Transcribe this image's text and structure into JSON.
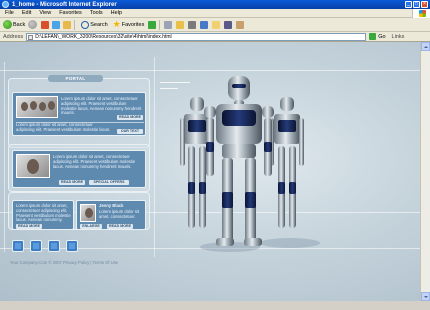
{
  "window": {
    "title": "1_home - Microsoft Internet Explorer",
    "buttons": [
      "_",
      "□",
      "×"
    ]
  },
  "menubar": {
    "items": [
      "File",
      "Edit",
      "View",
      "Favorites",
      "Tools",
      "Help"
    ]
  },
  "toolbar": {
    "back_label": "Back",
    "search_label": "Search",
    "favorites_label": "Favorites"
  },
  "addressbar": {
    "label": "Address",
    "value": "D:\\LEFAN\\_WORK_3200\\Resources\\32\\site\\4\\html\\index.html",
    "go_label": "Go",
    "links_label": "Links"
  },
  "page": {
    "panel_title": "PORTAL",
    "box1": {
      "text": "Lorem ipsum dolor sit amet, consectetuer adipiscing elit. Praesent vestibulum molestie lacus. Aenean nonummy hendrerit mauris.",
      "button": "READ MORE",
      "text2": "Lorem ipsum dolor sit amet, consectetuer adipiscing elit. Praesent vestibulum molestie lacus.",
      "button2": "OUR TEXT"
    },
    "box2": {
      "text": "Lorem ipsum dolor sit amet, consectetuer adipiscing elit. Praesent vestibulum molestie lacus. Aenean nonummy hendrerit mauris.",
      "button1": "READ MORE",
      "button2": "SPECIAL OFFERS"
    },
    "box3": {
      "text": "Lorem ipsum dolor sit amet, consectetuer adipiscing elit. Praesent vestibulum molestie lacus. Aenean nonummy.",
      "name": "Jenny Black",
      "name_text": "Lorem ipsum dolor sit amet, consectetuer.",
      "button1": "READ MORE",
      "button2": "ENLARGE",
      "button3": "READ MORE"
    },
    "footer": "Your Company.Com © 2007 Privacy Policy | Terms Of Use"
  },
  "colors": {
    "box_blue": "#5f8ab0",
    "accent_square": "#3f7ec4",
    "titlebar": "#0a5ad8"
  }
}
